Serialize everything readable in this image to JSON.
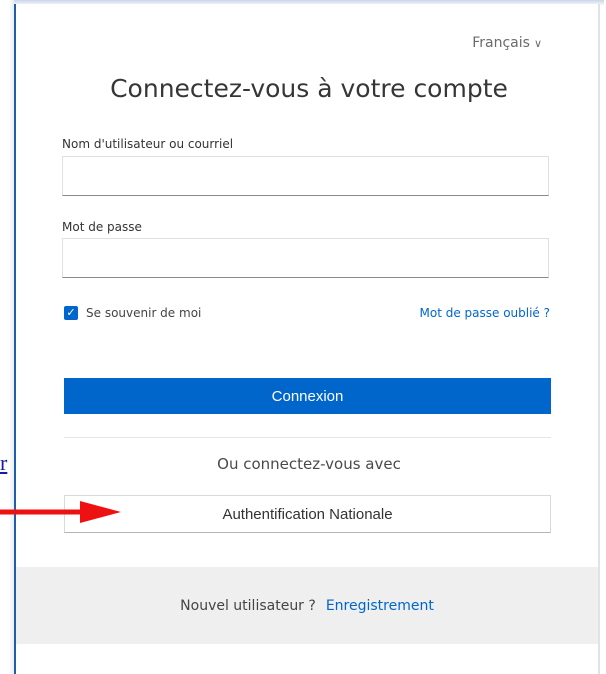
{
  "language": {
    "label": "Français",
    "chevron": "∨"
  },
  "title": "Connectez-vous à votre compte",
  "username": {
    "label": "Nom d'utilisateur ou courriel",
    "value": "",
    "placeholder": ""
  },
  "password": {
    "label": "Mot de passe",
    "value": "",
    "placeholder": ""
  },
  "remember": {
    "label": "Se souvenir de moi",
    "checked": true
  },
  "forgot_link": "Mot de passe oublié ?",
  "login_button": "Connexion",
  "alt_login_text": "Ou connectez-vous avec",
  "national_auth_button": "Authentification Nationale",
  "footer": {
    "new_user": "Nouvel utilisateur ?",
    "register_link": "Enregistrement"
  },
  "side_link": "r",
  "colors": {
    "accent": "#0066cc",
    "annotation_arrow": "#ee1111"
  }
}
